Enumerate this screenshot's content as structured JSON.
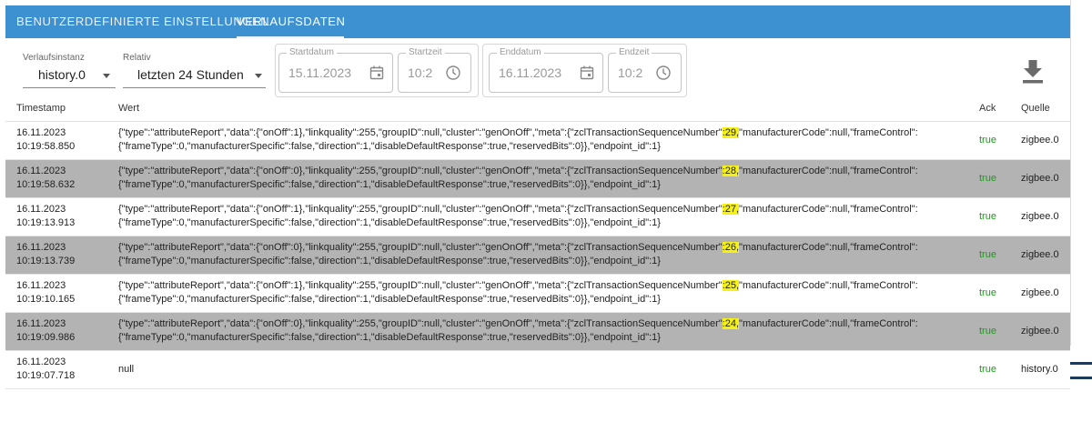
{
  "tabs": [
    {
      "label": "Benutzerdefinierte Einstellungen",
      "active": false
    },
    {
      "label": "Verlaufsdaten",
      "active": true
    }
  ],
  "filters": {
    "instance": {
      "label": "Verlaufsinstanz",
      "value": "history.0"
    },
    "relative": {
      "label": "Relativ",
      "value": "letzten 24 Stunden"
    },
    "start_date": {
      "label": "Startdatum",
      "value": "15.11.2023"
    },
    "start_time": {
      "label": "Startzeit",
      "value": "10:2"
    },
    "end_date": {
      "label": "Enddatum",
      "value": "16.11.2023"
    },
    "end_time": {
      "label": "Endzeit",
      "value": "10:2"
    }
  },
  "table": {
    "headers": {
      "timestamp": "Timestamp",
      "value": "Wert",
      "ack": "Ack",
      "source": "Quelle"
    },
    "rows": [
      {
        "date": "16.11.2023",
        "time": "10:19:58.850",
        "value_pre": "{\"type\":\"attributeReport\",\"data\":{\"onOff\":1},\"linkquality\":255,\"groupID\":null,\"cluster\":\"genOnOff\",\"meta\":{\"zclTransactionSequenceNumber\"",
        "value_hl": ":29,",
        "value_post": "\"manufacturerCode\":null,\"frameControl\":",
        "value_line2": "{\"frameType\":0,\"manufacturerSpecific\":false,\"direction\":1,\"disableDefaultResponse\":true,\"reservedBits\":0}},\"endpoint_id\":1}",
        "ack": "true",
        "source": "zigbee.0"
      },
      {
        "date": "16.11.2023",
        "time": "10:19:58.632",
        "value_pre": "{\"type\":\"attributeReport\",\"data\":{\"onOff\":0},\"linkquality\":255,\"groupID\":null,\"cluster\":\"genOnOff\",\"meta\":{\"zclTransactionSequenceNumber\"",
        "value_hl": ":28,",
        "value_post": "\"manufacturerCode\":null,\"frameControl\":",
        "value_line2": "{\"frameType\":0,\"manufacturerSpecific\":false,\"direction\":1,\"disableDefaultResponse\":true,\"reservedBits\":0}},\"endpoint_id\":1}",
        "ack": "true",
        "source": "zigbee.0"
      },
      {
        "date": "16.11.2023",
        "time": "10:19:13.913",
        "value_pre": "{\"type\":\"attributeReport\",\"data\":{\"onOff\":1},\"linkquality\":255,\"groupID\":null,\"cluster\":\"genOnOff\",\"meta\":{\"zclTransactionSequenceNumber\"",
        "value_hl": ":27,",
        "value_post": "\"manufacturerCode\":null,\"frameControl\":",
        "value_line2": "{\"frameType\":0,\"manufacturerSpecific\":false,\"direction\":1,\"disableDefaultResponse\":true,\"reservedBits\":0}},\"endpoint_id\":1}",
        "ack": "true",
        "source": "zigbee.0"
      },
      {
        "date": "16.11.2023",
        "time": "10:19:13.739",
        "value_pre": "{\"type\":\"attributeReport\",\"data\":{\"onOff\":0},\"linkquality\":255,\"groupID\":null,\"cluster\":\"genOnOff\",\"meta\":{\"zclTransactionSequenceNumber\"",
        "value_hl": ":26,",
        "value_post": "\"manufacturerCode\":null,\"frameControl\":",
        "value_line2": "{\"frameType\":0,\"manufacturerSpecific\":false,\"direction\":1,\"disableDefaultResponse\":true,\"reservedBits\":0}},\"endpoint_id\":1}",
        "ack": "true",
        "source": "zigbee.0"
      },
      {
        "date": "16.11.2023",
        "time": "10:19:10.165",
        "value_pre": "{\"type\":\"attributeReport\",\"data\":{\"onOff\":1},\"linkquality\":255,\"groupID\":null,\"cluster\":\"genOnOff\",\"meta\":{\"zclTransactionSequenceNumber\"",
        "value_hl": ":25,",
        "value_post": "\"manufacturerCode\":null,\"frameControl\":",
        "value_line2": "{\"frameType\":0,\"manufacturerSpecific\":false,\"direction\":1,\"disableDefaultResponse\":true,\"reservedBits\":0}},\"endpoint_id\":1}",
        "ack": "true",
        "source": "zigbee.0"
      },
      {
        "date": "16.11.2023",
        "time": "10:19:09.986",
        "value_pre": "{\"type\":\"attributeReport\",\"data\":{\"onOff\":0},\"linkquality\":255,\"groupID\":null,\"cluster\":\"genOnOff\",\"meta\":{\"zclTransactionSequenceNumber\"",
        "value_hl": ":24,",
        "value_post": "\"manufacturerCode\":null,\"frameControl\":",
        "value_line2": "{\"frameType\":0,\"manufacturerSpecific\":false,\"direction\":1,\"disableDefaultResponse\":true,\"reservedBits\":0}},\"endpoint_id\":1}",
        "ack": "true",
        "source": "zigbee.0"
      },
      {
        "date": "16.11.2023",
        "time": "10:19:07.718",
        "value_pre": "null",
        "value_hl": "",
        "value_post": "",
        "value_line2": "",
        "ack": "true",
        "source": "history.0"
      }
    ]
  },
  "colors": {
    "tabbar": "#3e91d1",
    "ack_true": "#1a9b1a",
    "row_alt": "#b3b3b3",
    "highlight": "#f5f116"
  },
  "icons": {
    "download": "download-icon",
    "calendar": "calendar-icon",
    "clock": "clock-icon",
    "dropdown": "chevron-down-icon"
  }
}
